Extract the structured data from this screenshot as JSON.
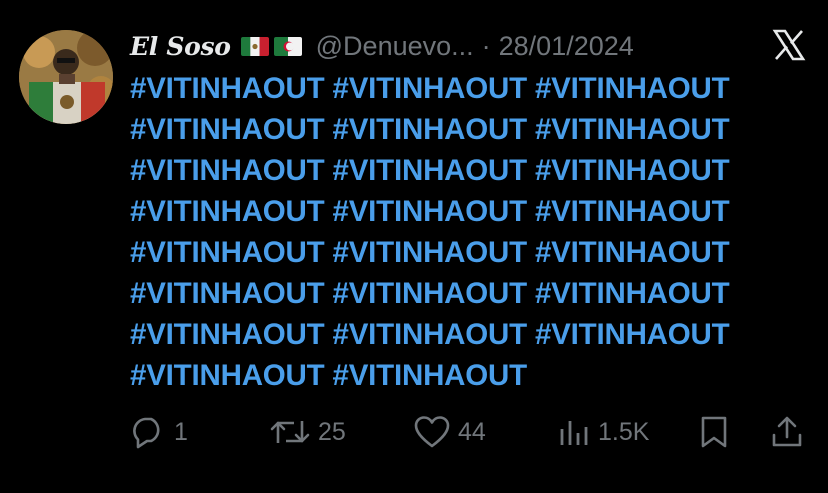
{
  "tweet": {
    "display_name": "El Soso",
    "flags": [
      "mexico-flag",
      "algeria-flag"
    ],
    "handle": "@Denuevo...",
    "separator": "·",
    "date": "28/01/2024",
    "hashtags": [
      "#VITINHAOUT",
      "#VITINHAOUT",
      "#VITINHAOUT",
      "#VITINHAOUT",
      "#VITINHAOUT",
      "#VITINHAOUT",
      "#VITINHAOUT",
      "#VITINHAOUT",
      "#VITINHAOUT",
      "#VITINHAOUT",
      "#VITINHAOUT",
      "#VITINHAOUT",
      "#VITINHAOUT",
      "#VITINHAOUT",
      "#VITINHAOUT",
      "#VITINHAOUT",
      "#VITINHAOUT",
      "#VITINHAOUT",
      "#VITINHAOUT",
      "#VITINHAOUT",
      "#VITINHAOUT",
      "#VITINHAOUT",
      "#VITINHAOUT"
    ]
  },
  "actions": {
    "replies": "1",
    "retweets": "25",
    "likes": "44",
    "views": "1.5K"
  },
  "icons": {
    "logo": "x-logo-icon",
    "reply": "reply-icon",
    "retweet": "retweet-icon",
    "like": "heart-icon",
    "views": "views-icon",
    "bookmark": "bookmark-icon",
    "share": "share-icon"
  },
  "colors": {
    "background": "#000000",
    "hashtag": "#4a9eea",
    "secondary_text": "#71767b",
    "primary_text": "#e7e9ea"
  }
}
